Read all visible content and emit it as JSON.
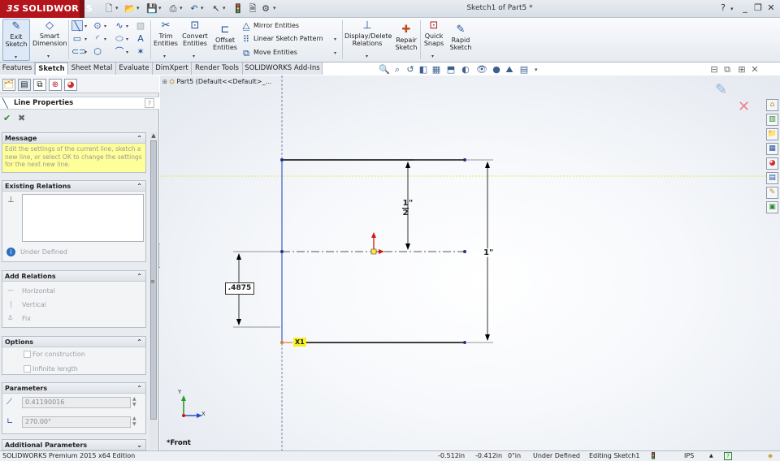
{
  "app": {
    "logo_text": "SOLIDWORKS",
    "logo_prefix": "3S",
    "document_title": "Sketch1 of Part5 *"
  },
  "colors": {
    "brand": "#b4141b",
    "sketch_line": "#000000",
    "construction": "#3b5bc4",
    "hint_bg": "#ffff99"
  },
  "ribbon": {
    "exit_sketch": "Exit\nSketch",
    "smart_dimension": "Smart\nDimension",
    "trim_entities": "Trim\nEntities",
    "convert_entities": "Convert\nEntities",
    "offset_entities": "Offset\nEntities",
    "mirror_entities": "Mirror Entities",
    "linear_sketch_pattern": "Linear Sketch Pattern",
    "move_entities": "Move Entities",
    "display_delete_relations": "Display/Delete\nRelations",
    "repair_sketch": "Repair\nSketch",
    "quick_snaps": "Quick\nSnaps",
    "rapid_sketch": "Rapid\nSketch"
  },
  "tabs": [
    {
      "label": "Features"
    },
    {
      "label": "Sketch"
    },
    {
      "label": "Sheet Metal"
    },
    {
      "label": "Evaluate"
    },
    {
      "label": "DimXpert"
    },
    {
      "label": "Render Tools"
    },
    {
      "label": "SOLIDWORKS Add-Ins"
    }
  ],
  "property_manager": {
    "title": "Line Properties",
    "message_header": "Message",
    "message_text": "Edit the settings of the current line, sketch a new line, or select OK to change the settings for the next new line.",
    "existing_relations_header": "Existing Relations",
    "relation_status": "Under Defined",
    "add_relations_header": "Add Relations",
    "add_relations": [
      "Horizontal",
      "Vertical",
      "Fix"
    ],
    "options_header": "Options",
    "options": [
      "For construction",
      "Infinite length"
    ],
    "parameters_header": "Parameters",
    "length_value": "0.41190016",
    "angle_value": "270.00°",
    "additional_parameters_header": "Additional Parameters"
  },
  "feature_tree": {
    "text": "Part5  (Default<<Default>_..."
  },
  "graphics": {
    "view_label": "*Front",
    "dim_half_num": "1",
    "dim_half_den": "2",
    "dim_half_unit": "\"",
    "dim_one": "1\"",
    "dim_edit_value": ".4875",
    "relation_tag": "X1",
    "axis_x": "X",
    "axis_y": "Y"
  },
  "status": {
    "edition": "SOLIDWORKS Premium 2015 x64 Edition",
    "x": "-0.512in",
    "y": "-0.412in",
    "z": "0\"in",
    "definition": "Under Defined",
    "mode": "Editing Sketch1",
    "units": "IPS"
  }
}
